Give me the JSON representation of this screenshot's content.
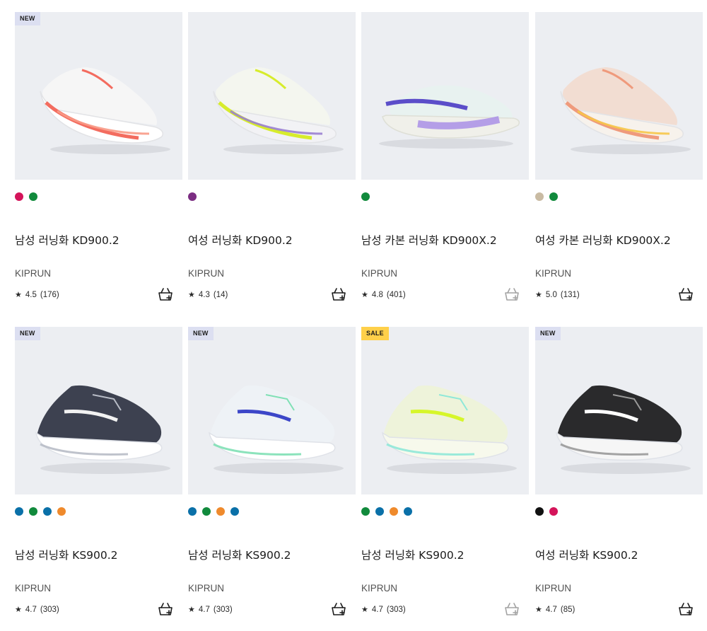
{
  "products": [
    {
      "badge": "NEW",
      "badge_type": "new",
      "swatches": [
        "#d4145a",
        "#118a3c"
      ],
      "title": "남성 러닝화 KD900.2",
      "brand": "KIPRUN",
      "rating": "4.5",
      "reviews": "(176)",
      "cart_enabled": true,
      "shoe": {
        "upper": "#f6f6f6",
        "accent": "#f36c5f",
        "sole": "#ffffff",
        "stripe": "#f89a86",
        "style": "racer"
      }
    },
    {
      "badge": "",
      "badge_type": "",
      "swatches": [
        "#7b2d82"
      ],
      "title": "여성 러닝화 KD900.2",
      "brand": "KIPRUN",
      "rating": "4.3",
      "reviews": "(14)",
      "cart_enabled": true,
      "shoe": {
        "upper": "#f4f6ef",
        "accent": "#d7ec2c",
        "sole": "#f2f2f5",
        "stripe": "#9a7fd1",
        "style": "racer"
      }
    },
    {
      "badge": "",
      "badge_type": "",
      "swatches": [
        "#118a3c"
      ],
      "title": "남성 카본 러닝화 KD900X.2",
      "brand": "KIPRUN",
      "rating": "4.8",
      "reviews": "(401)",
      "cart_enabled": false,
      "shoe": {
        "upper": "#e8f2f0",
        "accent": "#5b4ec9",
        "sole": "#f0f0ea",
        "stripe": "#a98fe6",
        "style": "flat"
      }
    },
    {
      "badge": "",
      "badge_type": "",
      "swatches": [
        "#c9bba3",
        "#118a3c"
      ],
      "title": "여성 카본 러닝화 KD900X.2",
      "brand": "KIPRUN",
      "rating": "5.0",
      "reviews": "(131)",
      "cart_enabled": true,
      "shoe": {
        "upper": "#f2ddd2",
        "accent": "#ef9a7c",
        "sole": "#f7f2ec",
        "stripe": "#f6c64a",
        "style": "racer"
      }
    },
    {
      "badge": "NEW",
      "badge_type": "new",
      "swatches": [
        "#0a70a8",
        "#118a3c",
        "#0a70a8",
        "#ef8a2c"
      ],
      "title": "남성 러닝화 KS900.2",
      "brand": "KIPRUN",
      "rating": "4.7",
      "reviews": "(303)",
      "cart_enabled": true,
      "shoe": {
        "upper": "#3d4150",
        "accent": "#f2f2f2",
        "sole": "#ffffff",
        "stripe": "#b8bcc6",
        "style": "cushion"
      }
    },
    {
      "badge": "NEW",
      "badge_type": "new",
      "swatches": [
        "#0a70a8",
        "#118a3c",
        "#ef8a2c",
        "#0a70a8"
      ],
      "title": "남성 러닝화 KS900.2",
      "brand": "KIPRUN",
      "rating": "4.7",
      "reviews": "(303)",
      "cart_enabled": true,
      "shoe": {
        "upper": "#eef2f6",
        "accent": "#3c46c8",
        "sole": "#ffffff",
        "stripe": "#7fe0b5",
        "style": "cushion"
      }
    },
    {
      "badge": "SALE",
      "badge_type": "sale",
      "swatches": [
        "#118a3c",
        "#0a70a8",
        "#ef8a2c",
        "#0a70a8"
      ],
      "title": "남성 러닝화 KS900.2",
      "brand": "KIPRUN",
      "rating": "4.7",
      "reviews": "(303)",
      "cart_enabled": false,
      "shoe": {
        "upper": "#eef3da",
        "accent": "#d6f62a",
        "sole": "#f7f9ec",
        "stripe": "#8fe8d8",
        "style": "cushion"
      }
    },
    {
      "badge": "NEW",
      "badge_type": "new",
      "swatches": [
        "#111111",
        "#d4145a"
      ],
      "title": "여성 러닝화 KS900.2",
      "brand": "KIPRUN",
      "rating": "4.7",
      "reviews": "(85)",
      "cart_enabled": true,
      "shoe": {
        "upper": "#2a2a2c",
        "accent": "#ffffff",
        "sole": "#f6f6f6",
        "stripe": "#9a9a9a",
        "style": "cushion"
      }
    }
  ]
}
